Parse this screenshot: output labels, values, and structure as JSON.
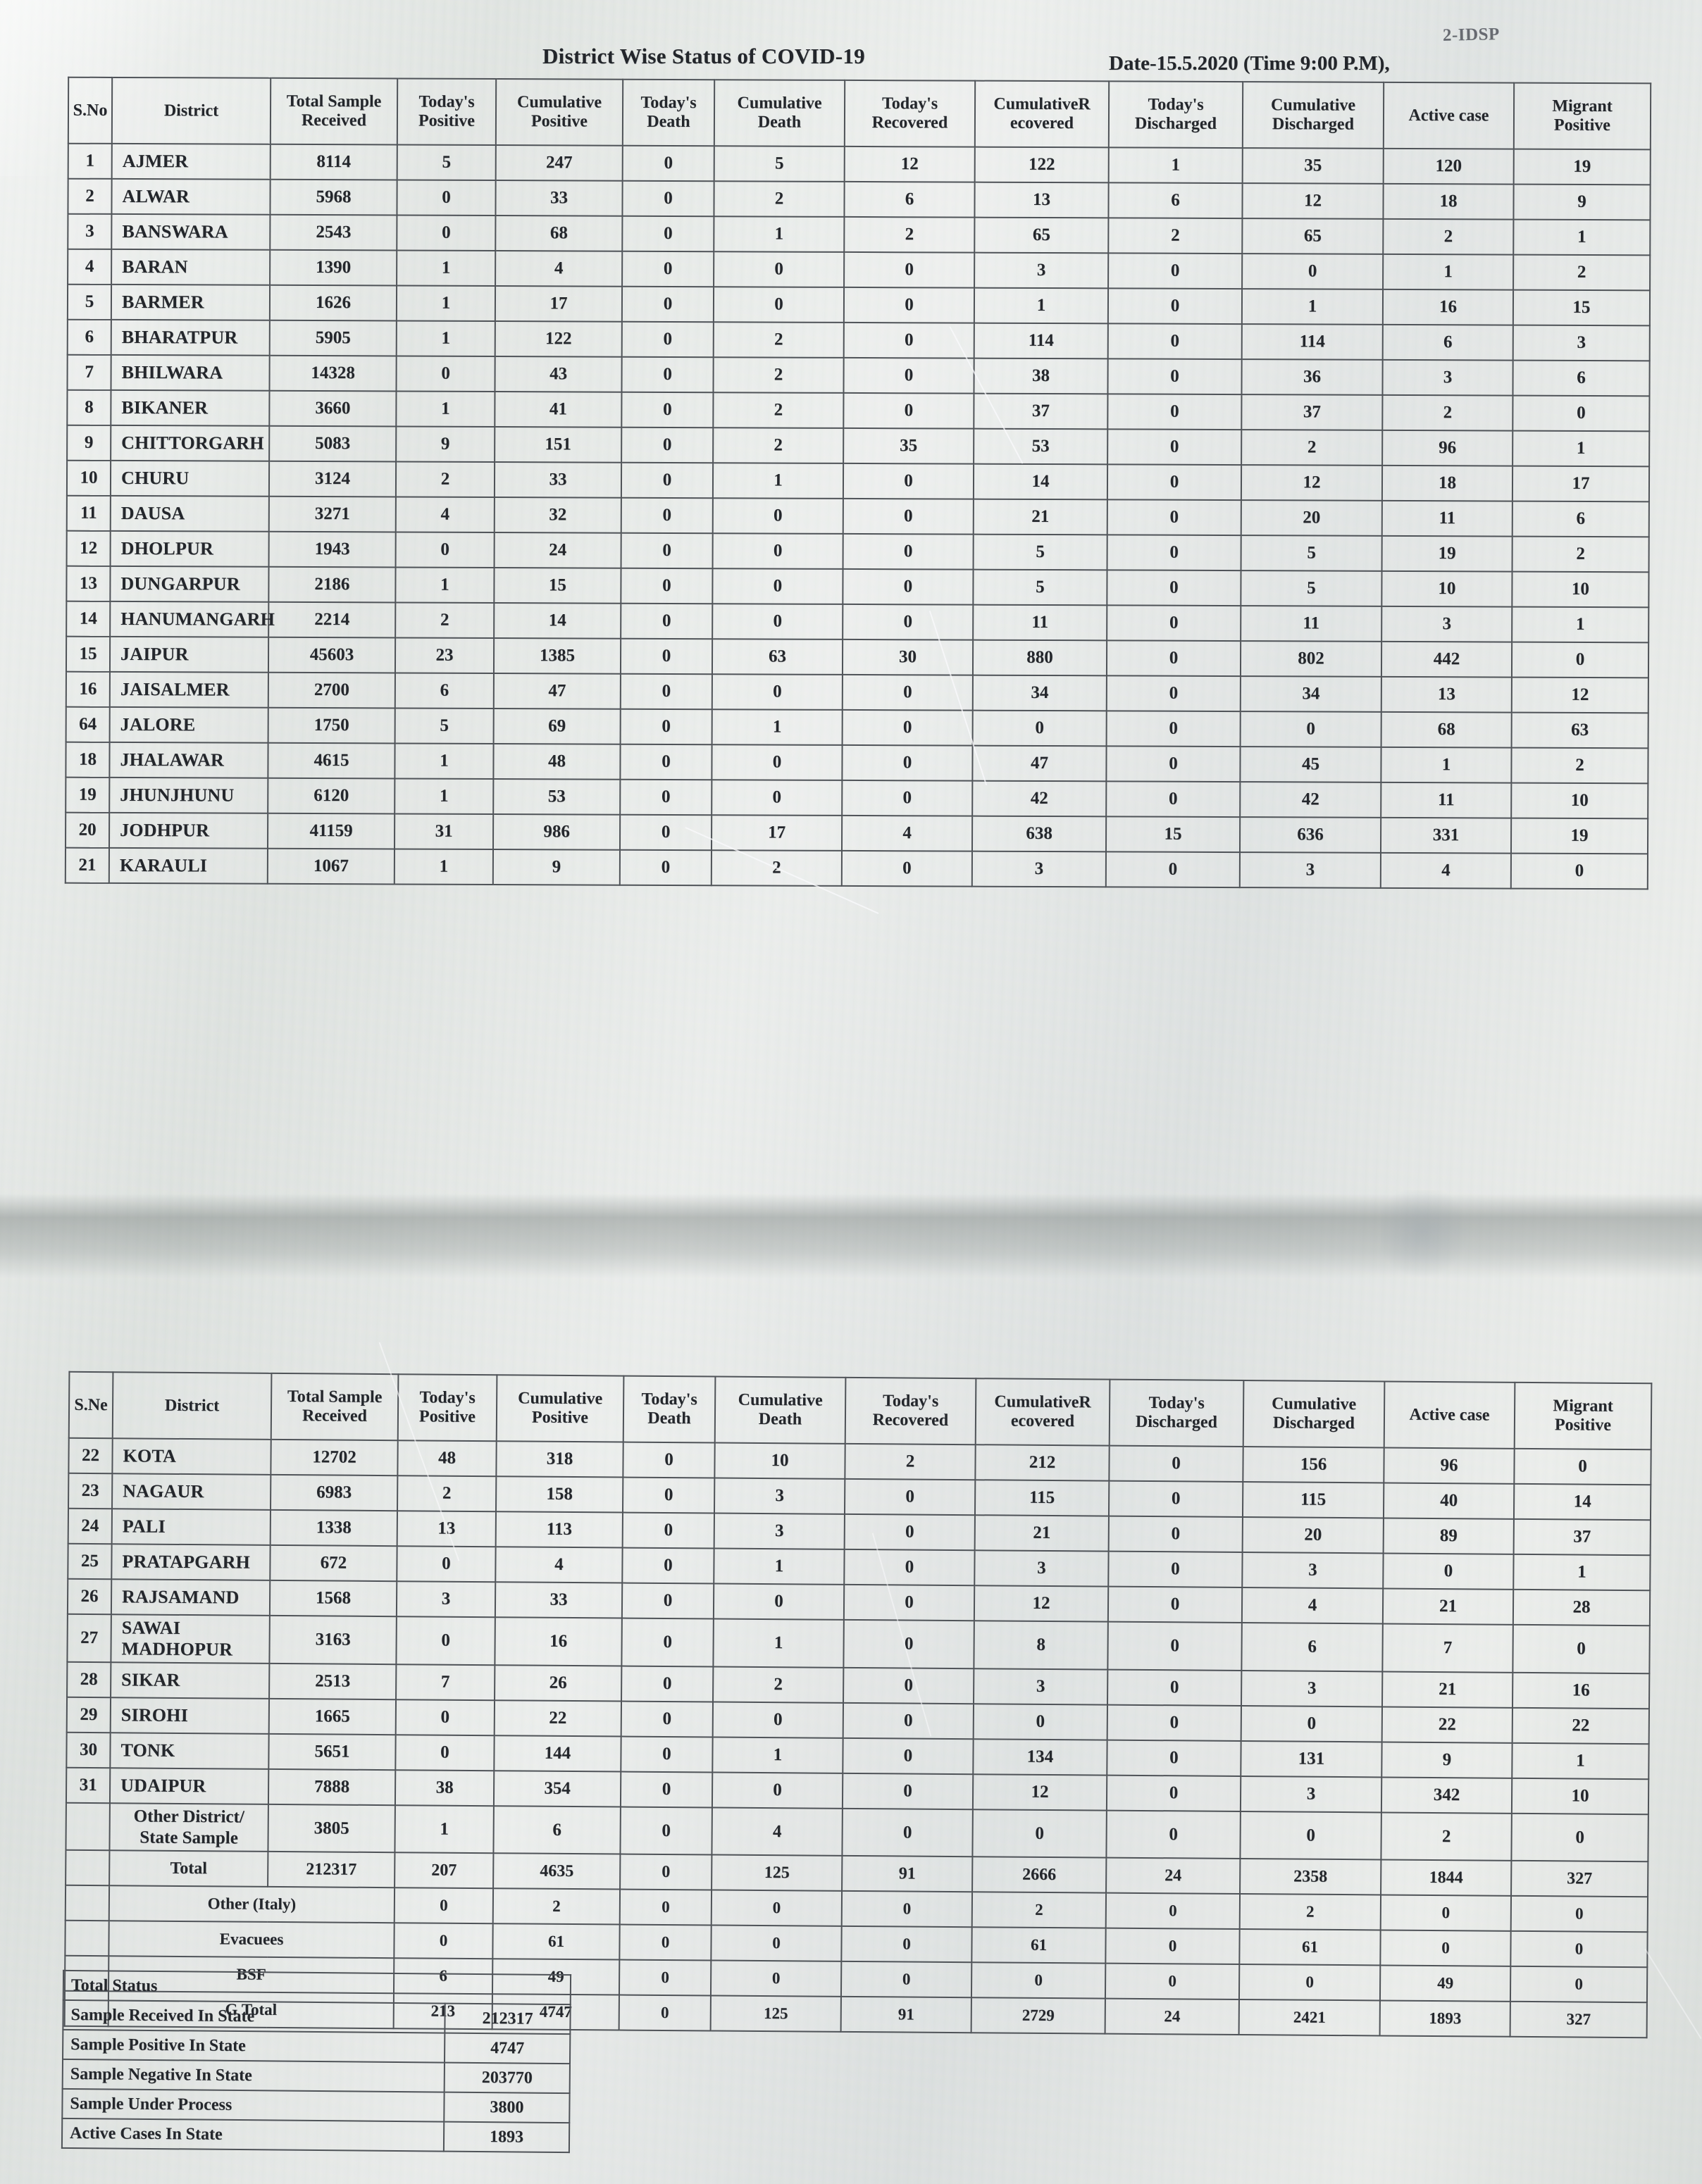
{
  "document": {
    "title": "District Wise Status of  COVID-19",
    "date": "Date-15.5.2020 (Time 9:00 P.M),",
    "stamp": "2-IDSP"
  },
  "columns": [
    "S.No",
    "District",
    "Total Sample Received",
    "Today's Positive",
    "Cumulative Positive",
    "Today's Death",
    "Cumulative Death",
    "Today's Recovered",
    "CumulativeRecovered",
    "Today's Discharged",
    "Cumulative Discharged",
    "Active  case",
    "Migrant Positive"
  ],
  "column_headers_2line": [
    {
      "l1": "S.No",
      "l2": ""
    },
    {
      "l1": "District",
      "l2": ""
    },
    {
      "l1": "Total Sample",
      "l2": "Received"
    },
    {
      "l1": "Today's",
      "l2": "Positive"
    },
    {
      "l1": "Cumulative",
      "l2": "Positive"
    },
    {
      "l1": "Today's",
      "l2": "Death"
    },
    {
      "l1": "Cumulative",
      "l2": "Death"
    },
    {
      "l1": "Today's",
      "l2": "Recovered"
    },
    {
      "l1": "CumulativeR",
      "l2": "ecovered"
    },
    {
      "l1": "Today's",
      "l2": "Discharged"
    },
    {
      "l1": "Cumulative",
      "l2": "Discharged"
    },
    {
      "l1": "Active  case",
      "l2": ""
    },
    {
      "l1": "Migrant",
      "l2": "Positive"
    }
  ],
  "table1": {
    "header_sno": "S.No",
    "rows": [
      {
        "sno": "1",
        "district": "AJMER",
        "total_sample": "8114",
        "today_positive": "5",
        "cum_positive": "247",
        "today_death": "0",
        "cum_death": "5",
        "today_recovered": "12",
        "cum_recovered": "122",
        "today_discharged": "1",
        "cum_discharged": "35",
        "active": "120",
        "migrant": "19"
      },
      {
        "sno": "2",
        "district": "ALWAR",
        "total_sample": "5968",
        "today_positive": "0",
        "cum_positive": "33",
        "today_death": "0",
        "cum_death": "2",
        "today_recovered": "6",
        "cum_recovered": "13",
        "today_discharged": "6",
        "cum_discharged": "12",
        "active": "18",
        "migrant": "9"
      },
      {
        "sno": "3",
        "district": "BANSWARA",
        "total_sample": "2543",
        "today_positive": "0",
        "cum_positive": "68",
        "today_death": "0",
        "cum_death": "1",
        "today_recovered": "2",
        "cum_recovered": "65",
        "today_discharged": "2",
        "cum_discharged": "65",
        "active": "2",
        "migrant": "1"
      },
      {
        "sno": "4",
        "district": "BARAN",
        "total_sample": "1390",
        "today_positive": "1",
        "cum_positive": "4",
        "today_death": "0",
        "cum_death": "0",
        "today_recovered": "0",
        "cum_recovered": "3",
        "today_discharged": "0",
        "cum_discharged": "0",
        "active": "1",
        "migrant": "2"
      },
      {
        "sno": "5",
        "district": "BARMER",
        "total_sample": "1626",
        "today_positive": "1",
        "cum_positive": "17",
        "today_death": "0",
        "cum_death": "0",
        "today_recovered": "0",
        "cum_recovered": "1",
        "today_discharged": "0",
        "cum_discharged": "1",
        "active": "16",
        "migrant": "15"
      },
      {
        "sno": "6",
        "district": "BHARATPUR",
        "total_sample": "5905",
        "today_positive": "1",
        "cum_positive": "122",
        "today_death": "0",
        "cum_death": "2",
        "today_recovered": "0",
        "cum_recovered": "114",
        "today_discharged": "0",
        "cum_discharged": "114",
        "active": "6",
        "migrant": "3"
      },
      {
        "sno": "7",
        "district": "BHILWARA",
        "total_sample": "14328",
        "today_positive": "0",
        "cum_positive": "43",
        "today_death": "0",
        "cum_death": "2",
        "today_recovered": "0",
        "cum_recovered": "38",
        "today_discharged": "0",
        "cum_discharged": "36",
        "active": "3",
        "migrant": "6"
      },
      {
        "sno": "8",
        "district": "BIKANER",
        "total_sample": "3660",
        "today_positive": "1",
        "cum_positive": "41",
        "today_death": "0",
        "cum_death": "2",
        "today_recovered": "0",
        "cum_recovered": "37",
        "today_discharged": "0",
        "cum_discharged": "37",
        "active": "2",
        "migrant": "0"
      },
      {
        "sno": "9",
        "district": "CHITTORGARH",
        "total_sample": "5083",
        "today_positive": "9",
        "cum_positive": "151",
        "today_death": "0",
        "cum_death": "2",
        "today_recovered": "35",
        "cum_recovered": "53",
        "today_discharged": "0",
        "cum_discharged": "2",
        "active": "96",
        "migrant": "1"
      },
      {
        "sno": "10",
        "district": "CHURU",
        "total_sample": "3124",
        "today_positive": "2",
        "cum_positive": "33",
        "today_death": "0",
        "cum_death": "1",
        "today_recovered": "0",
        "cum_recovered": "14",
        "today_discharged": "0",
        "cum_discharged": "12",
        "active": "18",
        "migrant": "17"
      },
      {
        "sno": "11",
        "district": "DAUSA",
        "total_sample": "3271",
        "today_positive": "4",
        "cum_positive": "32",
        "today_death": "0",
        "cum_death": "0",
        "today_recovered": "0",
        "cum_recovered": "21",
        "today_discharged": "0",
        "cum_discharged": "20",
        "active": "11",
        "migrant": "6"
      },
      {
        "sno": "12",
        "district": "DHOLPUR",
        "total_sample": "1943",
        "today_positive": "0",
        "cum_positive": "24",
        "today_death": "0",
        "cum_death": "0",
        "today_recovered": "0",
        "cum_recovered": "5",
        "today_discharged": "0",
        "cum_discharged": "5",
        "active": "19",
        "migrant": "2"
      },
      {
        "sno": "13",
        "district": "DUNGARPUR",
        "total_sample": "2186",
        "today_positive": "1",
        "cum_positive": "15",
        "today_death": "0",
        "cum_death": "0",
        "today_recovered": "0",
        "cum_recovered": "5",
        "today_discharged": "0",
        "cum_discharged": "5",
        "active": "10",
        "migrant": "10"
      },
      {
        "sno": "14",
        "district": "HANUMANGARH",
        "total_sample": "2214",
        "today_positive": "2",
        "cum_positive": "14",
        "today_death": "0",
        "cum_death": "0",
        "today_recovered": "0",
        "cum_recovered": "11",
        "today_discharged": "0",
        "cum_discharged": "11",
        "active": "3",
        "migrant": "1"
      },
      {
        "sno": "15",
        "district": "JAIPUR",
        "total_sample": "45603",
        "today_positive": "23",
        "cum_positive": "1385",
        "today_death": "0",
        "cum_death": "63",
        "today_recovered": "30",
        "cum_recovered": "880",
        "today_discharged": "0",
        "cum_discharged": "802",
        "active": "442",
        "migrant": "0"
      },
      {
        "sno": "16",
        "district": "JAISALMER",
        "total_sample": "2700",
        "today_positive": "6",
        "cum_positive": "47",
        "today_death": "0",
        "cum_death": "0",
        "today_recovered": "0",
        "cum_recovered": "34",
        "today_discharged": "0",
        "cum_discharged": "34",
        "active": "13",
        "migrant": "12"
      },
      {
        "sno": "64",
        "district": "JALORE",
        "total_sample": "1750",
        "today_positive": "5",
        "cum_positive": "69",
        "today_death": "0",
        "cum_death": "1",
        "today_recovered": "0",
        "cum_recovered": "0",
        "today_discharged": "0",
        "cum_discharged": "0",
        "active": "68",
        "migrant": "63"
      },
      {
        "sno": "18",
        "district": "JHALAWAR",
        "total_sample": "4615",
        "today_positive": "1",
        "cum_positive": "48",
        "today_death": "0",
        "cum_death": "0",
        "today_recovered": "0",
        "cum_recovered": "47",
        "today_discharged": "0",
        "cum_discharged": "45",
        "active": "1",
        "migrant": "2"
      },
      {
        "sno": "19",
        "district": "JHUNJHUNU",
        "total_sample": "6120",
        "today_positive": "1",
        "cum_positive": "53",
        "today_death": "0",
        "cum_death": "0",
        "today_recovered": "0",
        "cum_recovered": "42",
        "today_discharged": "0",
        "cum_discharged": "42",
        "active": "11",
        "migrant": "10"
      },
      {
        "sno": "20",
        "district": "JODHPUR",
        "total_sample": "41159",
        "today_positive": "31",
        "cum_positive": "986",
        "today_death": "0",
        "cum_death": "17",
        "today_recovered": "4",
        "cum_recovered": "638",
        "today_discharged": "15",
        "cum_discharged": "636",
        "active": "331",
        "migrant": "19"
      },
      {
        "sno": "21",
        "district": "KARAULI",
        "total_sample": "1067",
        "today_positive": "1",
        "cum_positive": "9",
        "today_death": "0",
        "cum_death": "2",
        "today_recovered": "0",
        "cum_recovered": "3",
        "today_discharged": "0",
        "cum_discharged": "3",
        "active": "4",
        "migrant": "0"
      }
    ]
  },
  "table2": {
    "header_sno": "S.Ne",
    "rows": [
      {
        "sno": "22",
        "district": "KOTA",
        "total_sample": "12702",
        "today_positive": "48",
        "cum_positive": "318",
        "today_death": "0",
        "cum_death": "10",
        "today_recovered": "2",
        "cum_recovered": "212",
        "today_discharged": "0",
        "cum_discharged": "156",
        "active": "96",
        "migrant": "0"
      },
      {
        "sno": "23",
        "district": "NAGAUR",
        "total_sample": "6983",
        "today_positive": "2",
        "cum_positive": "158",
        "today_death": "0",
        "cum_death": "3",
        "today_recovered": "0",
        "cum_recovered": "115",
        "today_discharged": "0",
        "cum_discharged": "115",
        "active": "40",
        "migrant": "14"
      },
      {
        "sno": "24",
        "district": "PALI",
        "total_sample": "1338",
        "today_positive": "13",
        "cum_positive": "113",
        "today_death": "0",
        "cum_death": "3",
        "today_recovered": "0",
        "cum_recovered": "21",
        "today_discharged": "0",
        "cum_discharged": "20",
        "active": "89",
        "migrant": "37"
      },
      {
        "sno": "25",
        "district": "PRATAPGARH",
        "total_sample": "672",
        "today_positive": "0",
        "cum_positive": "4",
        "today_death": "0",
        "cum_death": "1",
        "today_recovered": "0",
        "cum_recovered": "3",
        "today_discharged": "0",
        "cum_discharged": "3",
        "active": "0",
        "migrant": "1"
      },
      {
        "sno": "26",
        "district": "RAJSAMAND",
        "total_sample": "1568",
        "today_positive": "3",
        "cum_positive": "33",
        "today_death": "0",
        "cum_death": "0",
        "today_recovered": "0",
        "cum_recovered": "12",
        "today_discharged": "0",
        "cum_discharged": "4",
        "active": "21",
        "migrant": "28"
      },
      {
        "sno": "27",
        "district": "SAWAI MADHOPUR",
        "total_sample": "3163",
        "today_positive": "0",
        "cum_positive": "16",
        "today_death": "0",
        "cum_death": "1",
        "today_recovered": "0",
        "cum_recovered": "8",
        "today_discharged": "0",
        "cum_discharged": "6",
        "active": "7",
        "migrant": "0"
      },
      {
        "sno": "28",
        "district": "SIKAR",
        "total_sample": "2513",
        "today_positive": "7",
        "cum_positive": "26",
        "today_death": "0",
        "cum_death": "2",
        "today_recovered": "0",
        "cum_recovered": "3",
        "today_discharged": "0",
        "cum_discharged": "3",
        "active": "21",
        "migrant": "16"
      },
      {
        "sno": "29",
        "district": "SIROHI",
        "total_sample": "1665",
        "today_positive": "0",
        "cum_positive": "22",
        "today_death": "0",
        "cum_death": "0",
        "today_recovered": "0",
        "cum_recovered": "0",
        "today_discharged": "0",
        "cum_discharged": "0",
        "active": "22",
        "migrant": "22"
      },
      {
        "sno": "30",
        "district": "TONK",
        "total_sample": "5651",
        "today_positive": "0",
        "cum_positive": "144",
        "today_death": "0",
        "cum_death": "1",
        "today_recovered": "0",
        "cum_recovered": "134",
        "today_discharged": "0",
        "cum_discharged": "131",
        "active": "9",
        "migrant": "1"
      },
      {
        "sno": "31",
        "district": "UDAIPUR",
        "total_sample": "7888",
        "today_positive": "38",
        "cum_positive": "354",
        "today_death": "0",
        "cum_death": "0",
        "today_recovered": "0",
        "cum_recovered": "12",
        "today_discharged": "0",
        "cum_discharged": "3",
        "active": "342",
        "migrant": "10"
      }
    ],
    "other_district_row": {
      "sno": "",
      "district_line1": "Other District/",
      "district_line2": "State Sample",
      "total_sample": "3805",
      "today_positive": "1",
      "cum_positive": "6",
      "today_death": "0",
      "cum_death": "4",
      "today_recovered": "0",
      "cum_recovered": "0",
      "today_discharged": "0",
      "cum_discharged": "0",
      "active": "2",
      "migrant": "0"
    },
    "summary_rows": [
      {
        "label": "Total",
        "total_sample": "212317",
        "today_positive": "207",
        "cum_positive": "4635",
        "today_death": "0",
        "cum_death": "125",
        "today_recovered": "91",
        "cum_recovered": "2666",
        "today_discharged": "24",
        "cum_discharged": "2358",
        "active": "1844",
        "migrant": "327"
      },
      {
        "label": "Other (Italy)",
        "total_sample": "",
        "today_positive": "0",
        "cum_positive": "2",
        "today_death": "0",
        "cum_death": "0",
        "today_recovered": "0",
        "cum_recovered": "2",
        "today_discharged": "0",
        "cum_discharged": "2",
        "active": "0",
        "migrant": "0"
      },
      {
        "label": "Evacuees",
        "total_sample": "",
        "today_positive": "0",
        "cum_positive": "61",
        "today_death": "0",
        "cum_death": "0",
        "today_recovered": "0",
        "cum_recovered": "61",
        "today_discharged": "0",
        "cum_discharged": "61",
        "active": "0",
        "migrant": "0"
      },
      {
        "label": "BSF",
        "total_sample": "",
        "today_positive": "6",
        "cum_positive": "49",
        "today_death": "0",
        "cum_death": "0",
        "today_recovered": "0",
        "cum_recovered": "0",
        "today_discharged": "0",
        "cum_discharged": "0",
        "active": "49",
        "migrant": "0"
      },
      {
        "label": "G Total",
        "total_sample": "",
        "today_positive": "213",
        "cum_positive": "4747",
        "today_death": "0",
        "cum_death": "125",
        "today_recovered": "91",
        "cum_recovered": "2729",
        "today_discharged": "24",
        "cum_discharged": "2421",
        "active": "1893",
        "migrant": "327"
      }
    ]
  },
  "total_status": {
    "title": "Total Status",
    "rows": [
      {
        "label": "Sample Received In State",
        "value": "212317"
      },
      {
        "label": "Sample Positive In State",
        "value": "4747"
      },
      {
        "label": "Sample Negative In State",
        "value": "203770"
      },
      {
        "label": "Sample Under Process",
        "value": "3800"
      },
      {
        "label": "Active Cases In State",
        "value": "1893"
      }
    ]
  }
}
